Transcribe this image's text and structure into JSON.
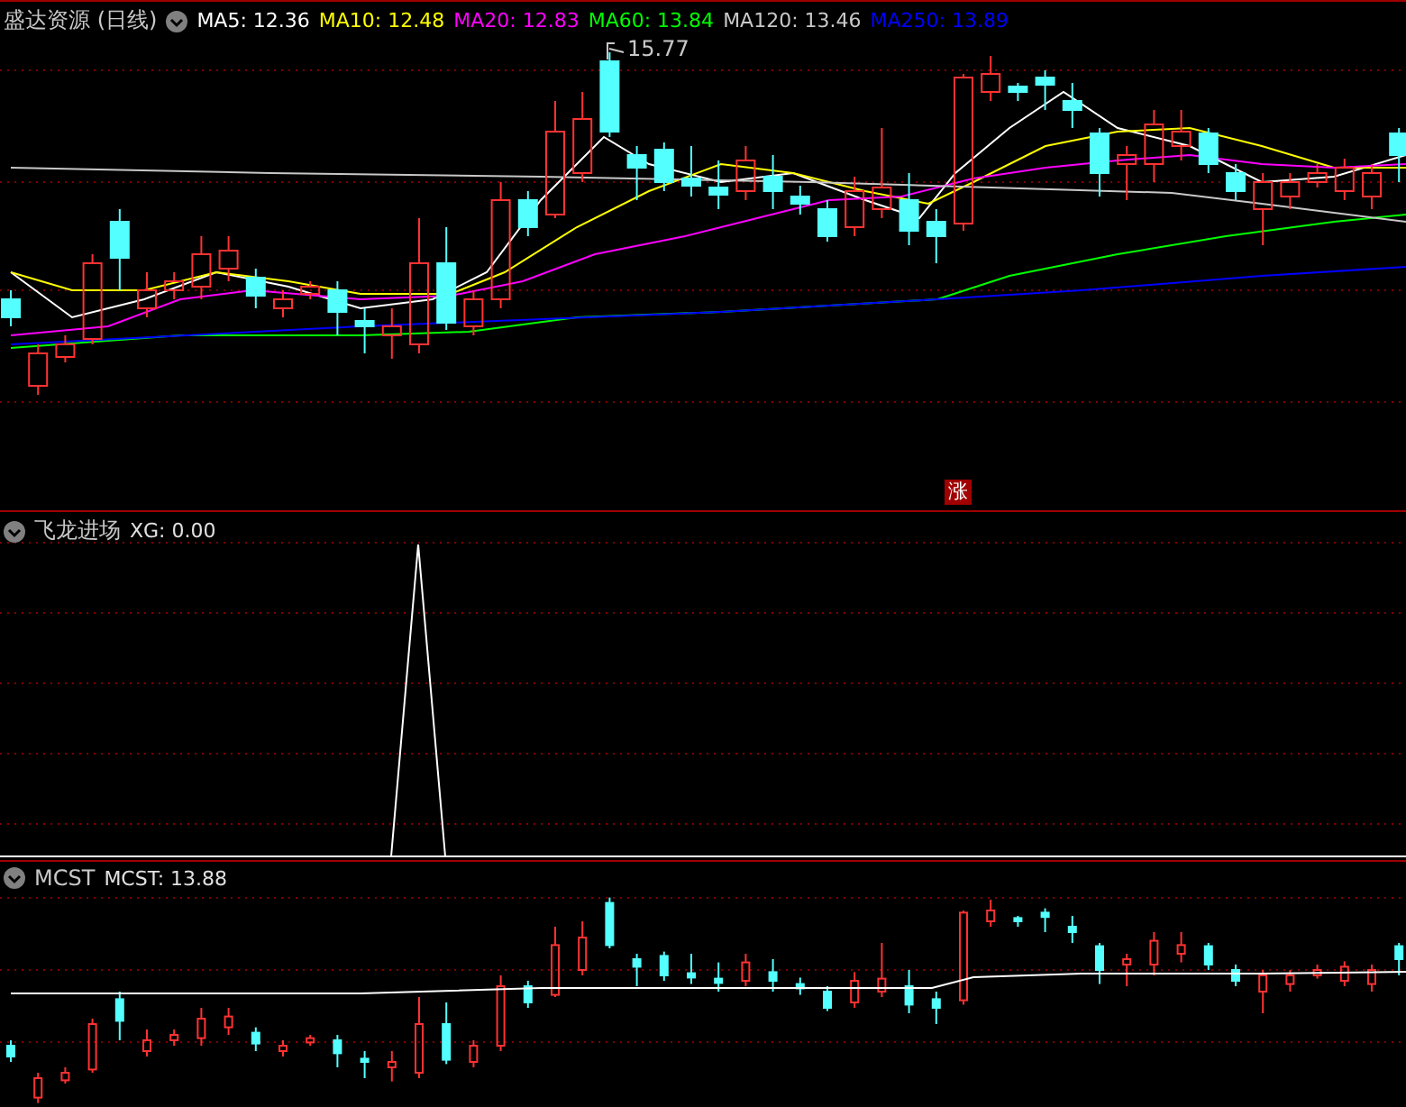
{
  "stock_panel": {
    "title": "盛达资源 (日线)",
    "indicators": [
      {
        "label": "MA5: 12.36",
        "color": "#ffffff"
      },
      {
        "label": "MA10: 12.48",
        "color": "#ffff00"
      },
      {
        "label": "MA20: 12.83",
        "color": "#ff00ff"
      },
      {
        "label": "MA60: 13.84",
        "color": "#00ff00"
      },
      {
        "label": "MA120: 13.46",
        "color": "#c8c8c8"
      },
      {
        "label": "MA250: 13.89",
        "color": "#0000ff"
      }
    ],
    "high_label": "15.77",
    "rise_badge": "涨"
  },
  "signal_panel": {
    "title": "飞龙进场",
    "reading": "XG: 0.00"
  },
  "cost_panel": {
    "title": "MCST",
    "reading": "MCST: 13.88"
  }
}
